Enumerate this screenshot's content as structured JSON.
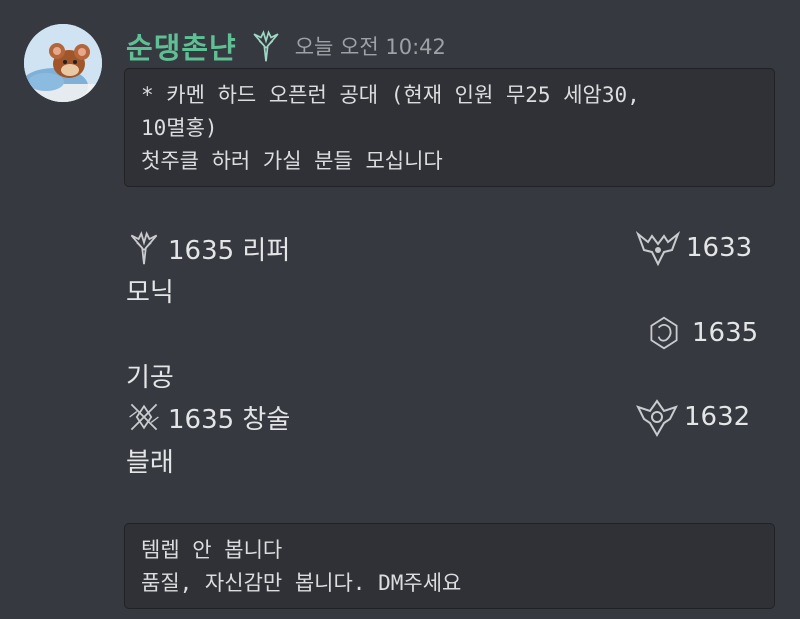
{
  "message": {
    "username": "순댕촌냔",
    "timestamp": "오늘 오전 10:42",
    "block1": {
      "line1": "* 카멘 하드 오픈런 공대 (현재 인원 무25 세암30,",
      "line2": "10멸홍)",
      "line3": "첫주클 하러 가실 분들 모십니다"
    },
    "roster": {
      "row1_left": "1635 리퍼",
      "row1_right": "1633",
      "row2_left": "모닉",
      "row3_right": "1635",
      "row4_left": "기공",
      "row5_left": "1635 창술",
      "row5_right": "1632",
      "row6_left": "블래"
    },
    "block2": {
      "line1": "템렙 안 봅니다",
      "line2": "품질, 자신감만 봅니다. DM주세요"
    }
  },
  "icons": {
    "badge": "reaper-class-icon",
    "row1_left": "reaper-class-icon",
    "row1_right": "demonic-class-icon",
    "row3_right": "class-emblem-icon",
    "row5_left": "lancemaster-class-icon",
    "row5_right": "class-crest-icon"
  }
}
